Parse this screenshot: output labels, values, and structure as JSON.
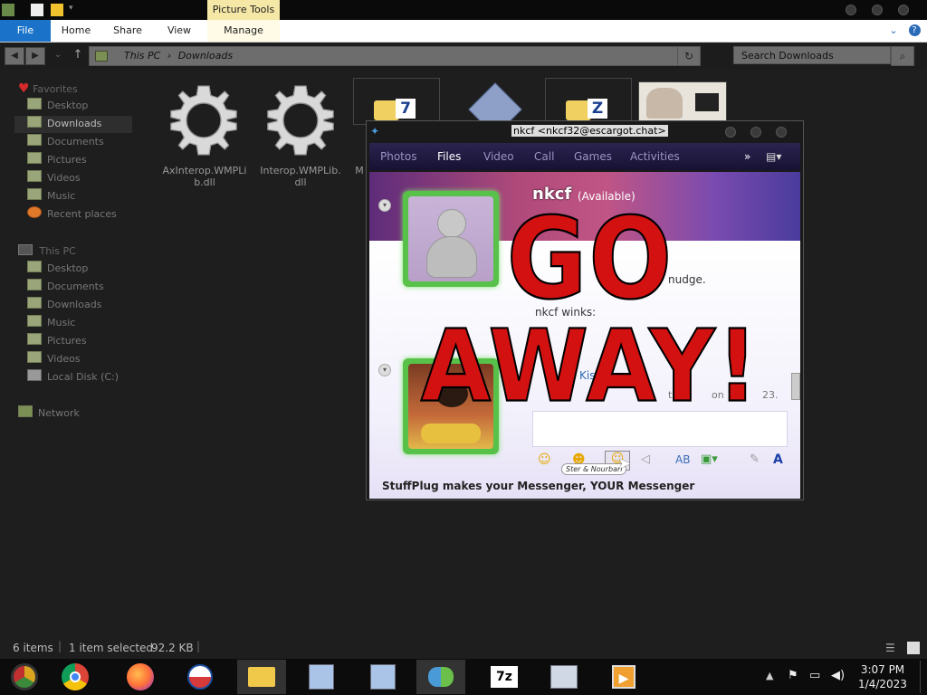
{
  "ribbon": {
    "contextual_group": "Picture Tools",
    "tabs": [
      "File",
      "Home",
      "Share",
      "View",
      "Manage"
    ]
  },
  "address": {
    "path": [
      "This PC",
      "Downloads"
    ],
    "search_placeholder": "Search Downloads"
  },
  "sidebar": {
    "favorites_header": "Favorites",
    "favorites": [
      "Desktop",
      "Downloads",
      "Documents",
      "Pictures",
      "Videos",
      "Music",
      "Recent places"
    ],
    "thispc_header": "This PC",
    "thispc": [
      "Desktop",
      "Documents",
      "Downloads",
      "Music",
      "Pictures",
      "Videos",
      "Local Disk (C:)"
    ],
    "network": "Network"
  },
  "files": [
    {
      "name": "AxInterop.WMPLib.dll",
      "line1": "AxInterop.WMPLi",
      "line2": "b.dll",
      "icon": "gear-icon"
    },
    {
      "name": "Interop.WMPLib.dll",
      "line1": "Interop.WMPLib.",
      "line2": "dll",
      "icon": "gear-icon"
    },
    {
      "name": "M",
      "line1": "M",
      "line2": "",
      "icon": "7z-archive-icon"
    }
  ],
  "messenger": {
    "title": "nkcf <nkcf32@escargot.chat>",
    "nav": [
      "Photos",
      "Files",
      "Video",
      "Call",
      "Games",
      "Activities"
    ],
    "name": "nkcf",
    "status": "(Available)",
    "line_nudge": "nudge.",
    "line_winks": "nkcf winks:",
    "line_partial1": "Kis",
    "line_partial2": "t 3",
    "line_partial3": "on 1/4",
    "line_partial4": "23.",
    "overlay_line1": "GO",
    "overlay_line2": "AWAY!",
    "tooltip": "Ster & Nourbari",
    "footer": "StuffPlug makes your Messenger, YOUR Messenger"
  },
  "status": {
    "items": "6 items",
    "selection": "1 item selected",
    "size": "92.2 KB"
  },
  "taskbar": {
    "apps": [
      "chrome-canary",
      "chrome",
      "firefox",
      "obama-logo",
      "file-explorer",
      "installer",
      "installer",
      "messenger",
      "7-zip",
      "task-manager",
      "media-player"
    ],
    "time": "3:07 PM",
    "date": "1/4/2023"
  },
  "colors": {
    "accent": "#1a73c9",
    "picture_tools": "#f5e7a6",
    "overlay_red": "#d41111"
  }
}
